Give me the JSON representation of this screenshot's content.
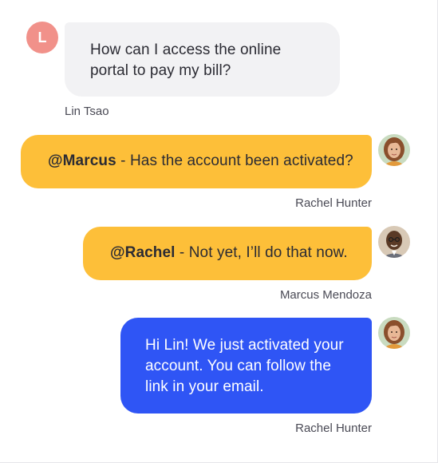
{
  "messages": [
    {
      "sender": "Lin Tsao",
      "avatar_initial": "L",
      "text": "How can I access the online portal to pay my bill?",
      "style": "incoming"
    },
    {
      "sender": "Rachel Hunter",
      "mention": "@Marcus",
      "text": " - Has the account been activated?",
      "style": "internal-note"
    },
    {
      "sender": "Marcus Mendoza",
      "mention": "@Rachel",
      "text": " - Not yet, I’ll do that now.",
      "style": "internal-note"
    },
    {
      "sender": "Rachel Hunter",
      "text": "Hi Lin! We just activated your account. You can follow the link in your email.",
      "style": "outgoing"
    }
  ],
  "colors": {
    "incoming_bubble": "#f2f2f4",
    "internal_note": "#fdbf39",
    "outgoing_bubble": "#2f55f5",
    "avatar_initial_bg": "#f1918a"
  }
}
